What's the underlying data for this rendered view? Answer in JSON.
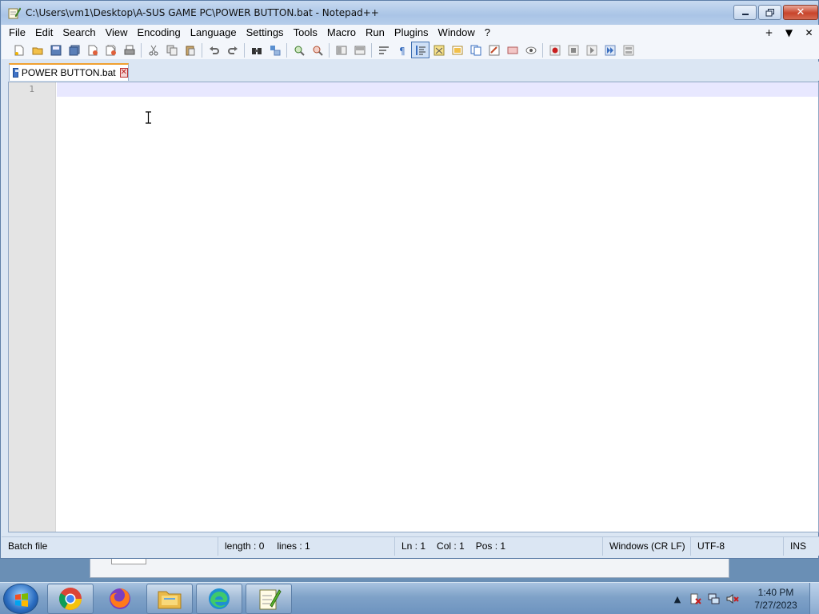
{
  "window": {
    "title": "C:\\Users\\vm1\\Desktop\\A-SUS GAME PC\\POWER BUTTON.bat - Notepad++",
    "controls": {
      "close_glyph": "✕"
    }
  },
  "menu": {
    "items": [
      "File",
      "Edit",
      "Search",
      "View",
      "Encoding",
      "Language",
      "Settings",
      "Tools",
      "Macro",
      "Run",
      "Plugins",
      "Window",
      "?"
    ],
    "right": {
      "add": "+",
      "dropdown": "▼",
      "close": "✕"
    }
  },
  "toolbar": {
    "icons": [
      "new-file-icon",
      "open-file-icon",
      "save-icon",
      "save-all-icon",
      "close-icon",
      "close-all-icon",
      "print-icon",
      "cut-icon",
      "copy-icon",
      "paste-icon",
      "undo-icon",
      "redo-icon",
      "find-icon",
      "replace-icon",
      "zoom-in-icon",
      "zoom-out-icon",
      "sync-vertical-icon",
      "sync-horizontal-icon",
      "word-wrap-icon",
      "show-all-characters-icon",
      "indent-guide-icon",
      "user-language-icon",
      "document-map-icon",
      "function-list-icon",
      "folder-as-workspace-icon",
      "monitoring-icon",
      "record-macro-icon",
      "stop-recording-icon",
      "playback-macro-icon",
      "run-macro-multiple-icon",
      "save-macro-icon"
    ]
  },
  "tab": {
    "label": "POWER BUTTON.bat",
    "close": "✕"
  },
  "editor": {
    "line_numbers": [
      "1"
    ],
    "content": ""
  },
  "statusbar": {
    "file_type": "Batch file",
    "length": "length : 0",
    "lines": "lines : 1",
    "ln": "Ln : 1",
    "col": "Col : 1",
    "pos": "Pos : 1",
    "eol": "Windows (CR LF)",
    "encoding": "UTF-8",
    "mode": "INS"
  },
  "taskbar": {
    "apps": [
      "chrome-icon",
      "firefox-icon",
      "file-explorer-icon",
      "edge-icon",
      "notepad-plus-plus-icon"
    ],
    "tray": {
      "time": "1:40 PM",
      "date": "7/27/2023",
      "overflow": "▲"
    }
  },
  "colors": {
    "title_gradient_top": "#c8daf0",
    "current_line": "#e8e8ff",
    "gutter": "#e4e4e4",
    "close_button": "#c8442b",
    "taskbar": "#7fa2c8"
  }
}
